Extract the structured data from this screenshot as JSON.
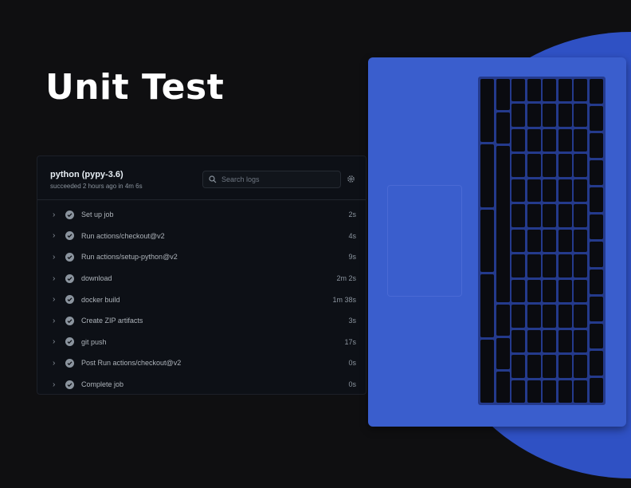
{
  "heading": "Unit Test",
  "job": {
    "name": "python (pypy-3.6)",
    "status": "succeeded 2 hours ago in 4m 6s"
  },
  "search": {
    "placeholder": "Search logs"
  },
  "steps": [
    {
      "label": "Set up job",
      "duration": "2s"
    },
    {
      "label": "Run actions/checkout@v2",
      "duration": "4s"
    },
    {
      "label": "Run actions/setup-python@v2",
      "duration": "9s"
    },
    {
      "label": "download",
      "duration": "2m 2s"
    },
    {
      "label": "docker build",
      "duration": "1m 38s"
    },
    {
      "label": "Create ZIP artifacts",
      "duration": "3s"
    },
    {
      "label": "git push",
      "duration": "17s"
    },
    {
      "label": "Post Run actions/checkout@v2",
      "duration": "0s"
    },
    {
      "label": "Complete job",
      "duration": "0s"
    }
  ],
  "colors": {
    "accent": "#3a5ecd",
    "background": "#0f0f11"
  }
}
